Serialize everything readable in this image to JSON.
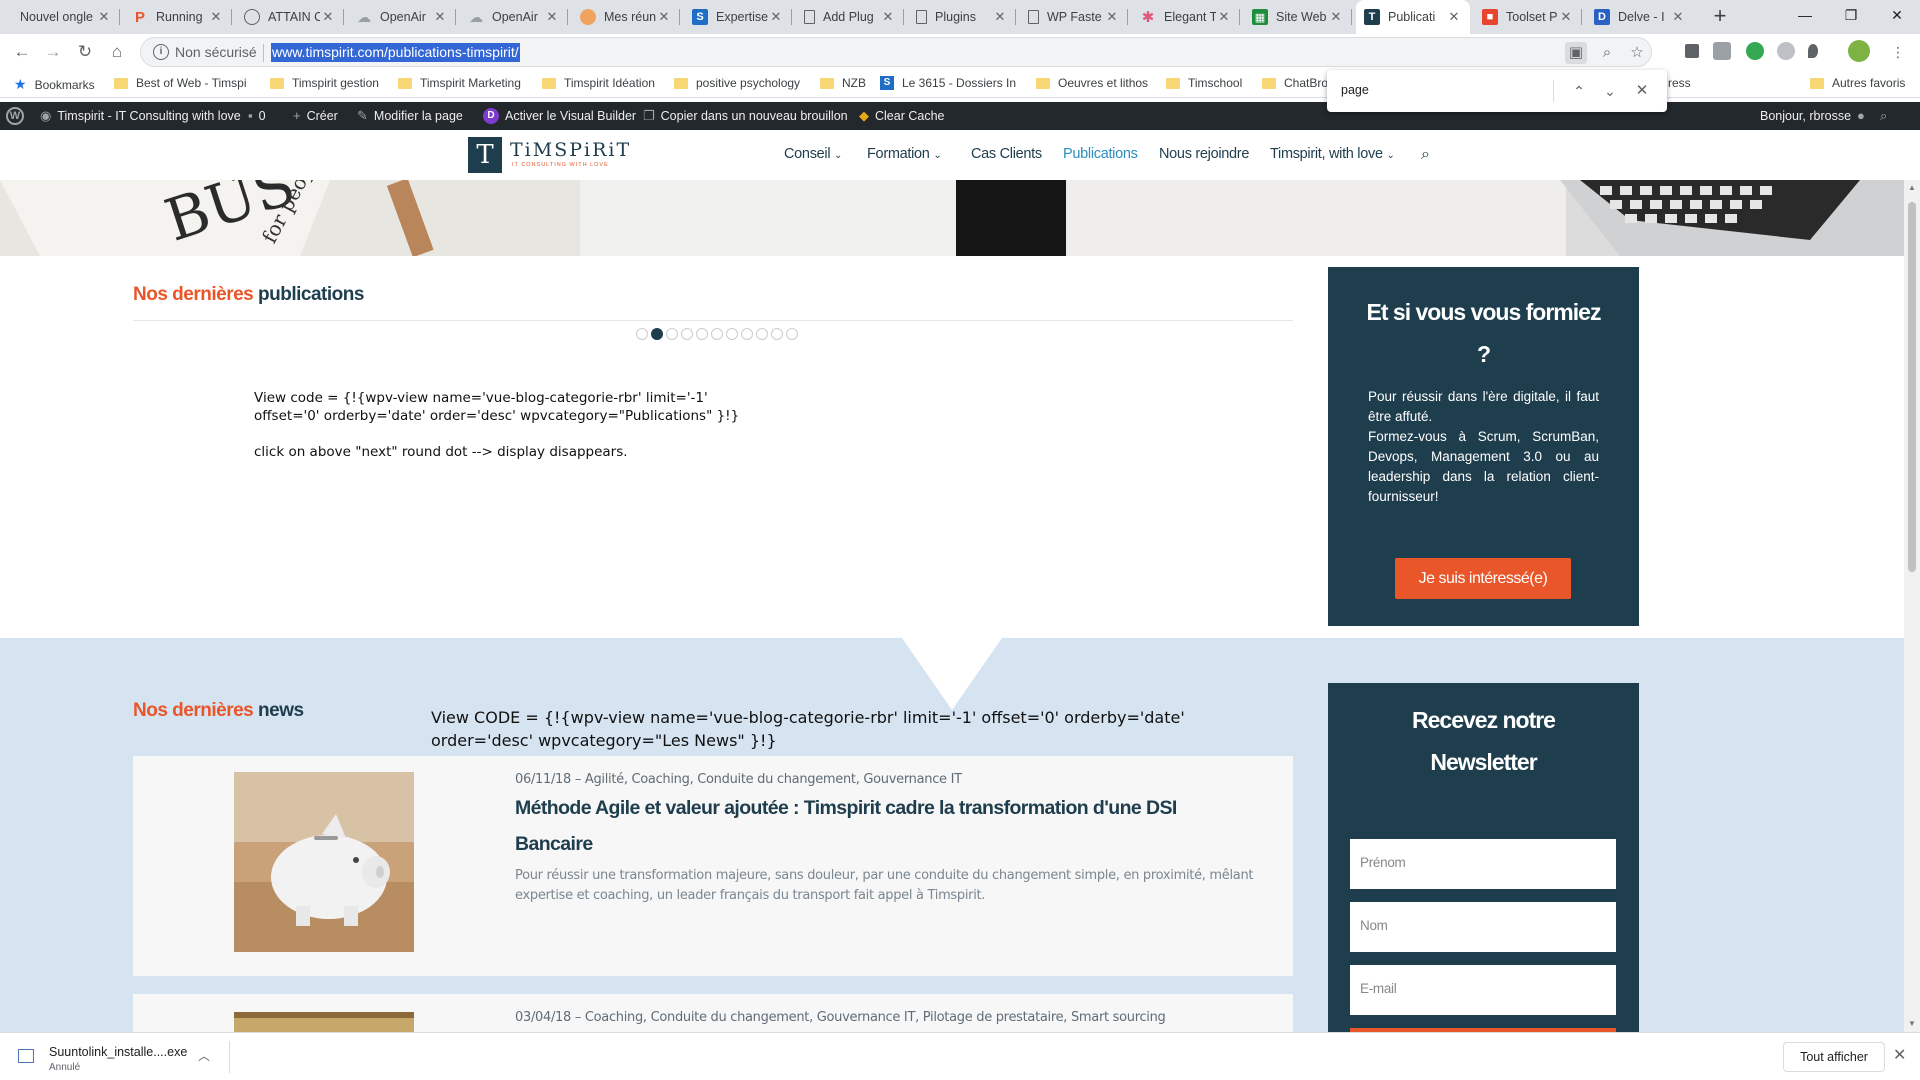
{
  "browser": {
    "tabs": [
      {
        "title": "Nouvel ongle",
        "icon": "none"
      },
      {
        "title": "Running",
        "icon": "p-logo-icon"
      },
      {
        "title": "ATTAIN C",
        "icon": "globe-icon"
      },
      {
        "title": "OpenAir",
        "icon": "cloud-icon"
      },
      {
        "title": "OpenAir",
        "icon": "cloud-icon"
      },
      {
        "title": "Mes réun",
        "icon": "gear-badge-icon"
      },
      {
        "title": "Expertise",
        "icon": "sharepoint-icon"
      },
      {
        "title": "Add Plug",
        "icon": "page-icon"
      },
      {
        "title": "Plugins",
        "icon": "page-icon"
      },
      {
        "title": "WP Faste",
        "icon": "page-icon"
      },
      {
        "title": "Elegant T",
        "icon": "flower-icon"
      },
      {
        "title": "Site Web",
        "icon": "sheets-icon"
      },
      {
        "title": "Publicati",
        "icon": "timspirit-icon"
      },
      {
        "title": "Toolset P",
        "icon": "toolset-icon"
      },
      {
        "title": "Delve - I",
        "icon": "office-icon"
      }
    ],
    "new_tab": "+",
    "address": {
      "security": "Non sécurisé",
      "url": "www.timspirit.com/publications-timspirit/"
    },
    "bookmarks": [
      {
        "label": "Bookmarks",
        "type": "star"
      },
      {
        "label": "Best of Web - Timspi",
        "type": "folder"
      },
      {
        "label": "Timspirit gestion",
        "type": "folder"
      },
      {
        "label": "Timspirit Marketing",
        "type": "folder"
      },
      {
        "label": "Timspirit Idéation",
        "type": "folder"
      },
      {
        "label": "positive psychology",
        "type": "folder"
      },
      {
        "label": "NZB",
        "type": "folder"
      },
      {
        "label": "Le 3615 - Dossiers In",
        "type": "sharepoint"
      },
      {
        "label": "Oeuvres et lithos",
        "type": "folder"
      },
      {
        "label": "Timschool",
        "type": "folder"
      },
      {
        "label": "ChatBro",
        "type": "folder"
      },
      {
        "label": "ress",
        "type": "none"
      },
      {
        "label": "Autres favoris",
        "type": "folder"
      }
    ],
    "find": {
      "query": "page"
    }
  },
  "wp_admin": {
    "site": "Timspirit - IT Consulting with love",
    "comments": "0",
    "create": "Créer",
    "edit": "Modifier la page",
    "visual_builder": "Activer le Visual Builder",
    "copy_draft": "Copier dans un nouveau brouillon",
    "clear_cache": "Clear Cache",
    "greeting": "Bonjour, rbrosse"
  },
  "site": {
    "logo_text": "TiMSPiRiT",
    "logo_tagline": "IT CONSULTING WITH LOVE",
    "menu": [
      {
        "label": "Conseil",
        "dropdown": true
      },
      {
        "label": "Formation",
        "dropdown": true
      },
      {
        "label": "Cas Clients",
        "dropdown": false
      },
      {
        "label": "Publications",
        "dropdown": false,
        "active": true
      },
      {
        "label": "Nous rejoindre",
        "dropdown": false
      },
      {
        "label": "Timspirit, with love",
        "dropdown": true
      }
    ],
    "publications": {
      "title_highlight": "Nos dernières",
      "title_rest": "publications",
      "pager_total": 11,
      "pager_active": 1,
      "note_code": "View code = {!{wpv-view name='vue-blog-categorie-rbr' limit='-1' offset='0' orderby='date' order='desc' wpvcategory=\"Publications\" }!}",
      "note_hint": "click on above \"next\" round dot --> display disappears."
    },
    "promo": {
      "title": "Et si vous vous formiez ?",
      "body_1": "Pour réussir dans l'ère digitale, il faut être affuté.",
      "body_2": "Formez-vous à Scrum, ScrumBan, Devops, Management 3.0 ou au leadership dans la relation client-fournisseur!",
      "cta": "Je suis intéressé(e)"
    },
    "news": {
      "title_highlight": "Nos dernières",
      "title_rest": "news",
      "code": "View CODE = {!{wpv-view name='vue-blog-categorie-rbr' limit='-1' offset='0' orderby='date' order='desc' wpvcategory=\"Les News\" }!}",
      "items": [
        {
          "meta": "06/11/18 – Agilité, Coaching, Conduite du changement, Gouvernance IT",
          "title": "Méthode Agile et valeur ajoutée : Timspirit cadre la transformation d'une DSI Bancaire",
          "excerpt": "Pour réussir une transformation majeure, sans douleur, par une conduite du changement simple, en proximité, mêlant expertise et coaching, un leader français du transport fait appel à Timspirit."
        },
        {
          "meta": "03/04/18 – Coaching, Conduite du changement, Gouvernance IT, Pilotage de prestataire, Smart sourcing",
          "title": "",
          "excerpt": ""
        }
      ]
    },
    "newsletter": {
      "title": "Recevez notre Newsletter",
      "first_name": "Prénom",
      "last_name": "Nom",
      "email": "E-mail"
    }
  },
  "downloads": {
    "file": "Suuntolink_installe....exe",
    "status": "Annulé",
    "show_all": "Tout afficher"
  },
  "colors": {
    "brand_dark": "#1e3d4d",
    "brand_orange": "#e8562a",
    "menu_active": "#2a8fbd",
    "section_blue": "#d6e3f1"
  }
}
